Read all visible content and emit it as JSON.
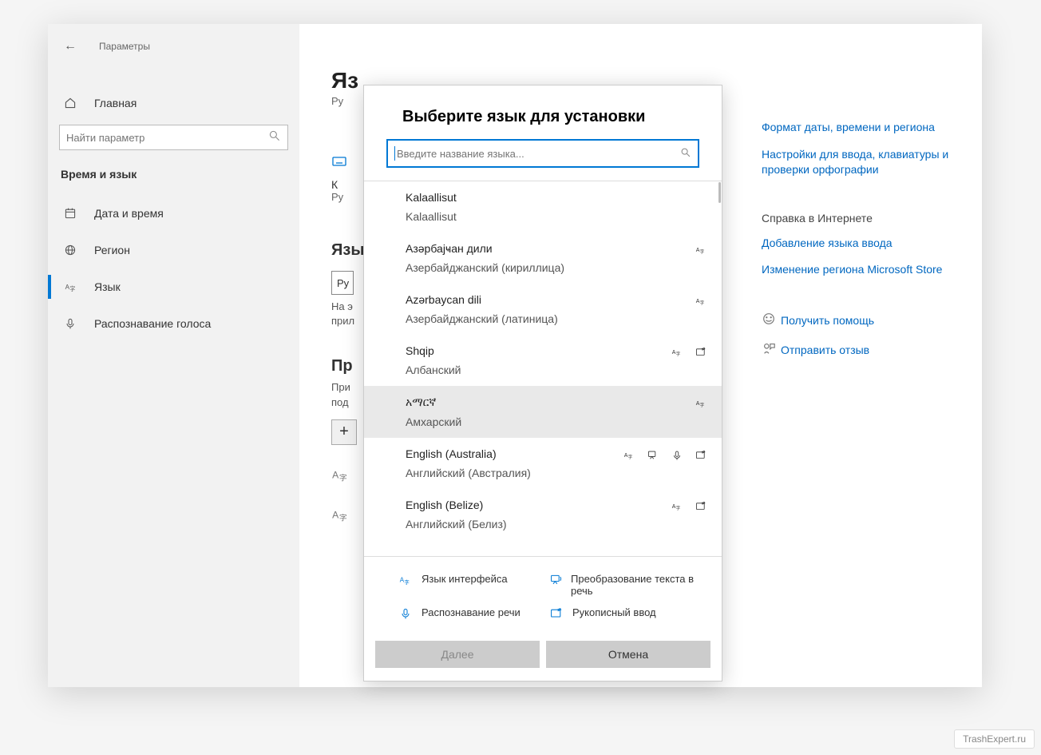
{
  "titlebar": {
    "close": "✕"
  },
  "sidebar": {
    "back_label": "Параметры",
    "home_label": "Главная",
    "search_placeholder": "Найти параметр",
    "section": "Время и язык",
    "items": [
      {
        "label": "Дата и время"
      },
      {
        "label": "Регион"
      },
      {
        "label": "Язык"
      },
      {
        "label": "Распознавание голоса"
      }
    ]
  },
  "main": {
    "heading_fragment": "Яз",
    "sub1": "Ру",
    "kb_initial": "К",
    "kb_sub": "Ру",
    "lang_heading": "Язы",
    "lang_field": "Ру",
    "lang_note1": "На э",
    "lang_note2": "прил",
    "pref_heading": "Пр",
    "pref_note1": "При",
    "pref_note2": "под",
    "add": "+"
  },
  "related": {
    "links1": [
      "Формат даты, времени и региона",
      "Настройки для ввода, клавиатуры и проверки орфографии"
    ],
    "help_head": "Справка в Интернете",
    "links2": [
      "Добавление языка ввода",
      "Изменение региона Microsoft Store"
    ],
    "links3": [
      "Получить помощь",
      "Отправить отзыв"
    ]
  },
  "modal": {
    "title": "Выберите язык для установки",
    "search_placeholder": "Введите название языка...",
    "languages": [
      {
        "native": "Kalaallisut",
        "translated": "Kalaallisut",
        "features": []
      },
      {
        "native": "Азәрбајҹан дили",
        "translated": "Азербайджанский (кириллица)",
        "features": [
          "lang"
        ]
      },
      {
        "native": "Azərbaycan dili",
        "translated": "Азербайджанский (латиница)",
        "features": [
          "lang"
        ]
      },
      {
        "native": "Shqip",
        "translated": "Албанский",
        "features": [
          "lang",
          "hand"
        ]
      },
      {
        "native": "አማርኛ",
        "translated": "Амхарский",
        "features": [
          "lang"
        ],
        "hover": true
      },
      {
        "native": "English (Australia)",
        "translated": "Английский (Австралия)",
        "features": [
          "lang",
          "tts",
          "speech",
          "hand"
        ]
      },
      {
        "native": "English (Belize)",
        "translated": "Английский (Белиз)",
        "features": [
          "lang",
          "hand"
        ]
      }
    ],
    "legend": {
      "display": "Язык интерфейса",
      "tts": "Преобразование текста в речь",
      "speech": "Распознавание речи",
      "hand": "Рукописный ввод"
    },
    "next": "Далее",
    "cancel": "Отмена"
  },
  "watermark": "TrashExpert.ru"
}
